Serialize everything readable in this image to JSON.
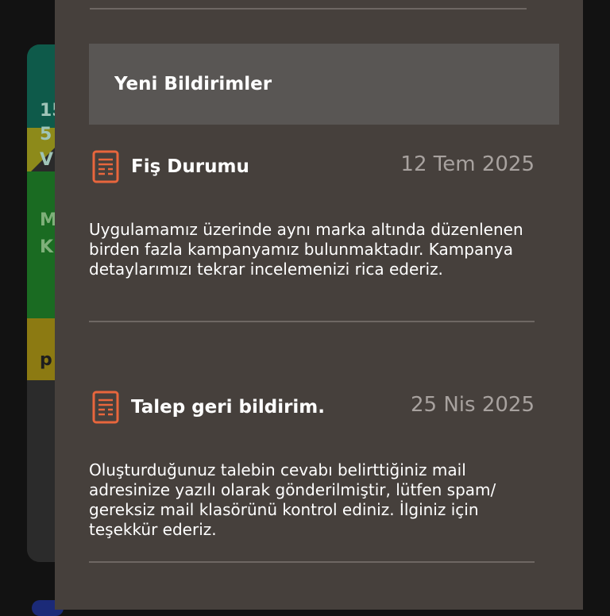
{
  "background": {
    "card_lines": [
      "15",
      "5",
      "V",
      "M",
      "K",
      "p"
    ]
  },
  "drawer": {
    "section_title": "Yeni Bildirimler",
    "notifications": [
      {
        "icon": "receipt-icon",
        "title": "Fiş Durumu",
        "date": "12 Tem 2025",
        "body": "Uygulamamız üzerinde aynı marka altında düzenlenen birden fazla kampanyamız bulunmaktadır. Kampanya detaylarımızı tekrar incelemenizi rica ederiz."
      },
      {
        "icon": "receipt-icon",
        "title": "Talep geri bildirim.",
        "date": "25 Nis 2025",
        "body": "Oluşturduğunuz talebin cevabı belirttiğiniz mail adresinize yazılı olarak gönderilmiştir, lütfen spam/ gereksiz mail klasörünü kontrol ediniz. İlginiz için teşekkür ederiz."
      }
    ]
  },
  "colors": {
    "drawer_bg": "#46403c",
    "header_bg": "#595654",
    "accent": "#e8663d"
  }
}
